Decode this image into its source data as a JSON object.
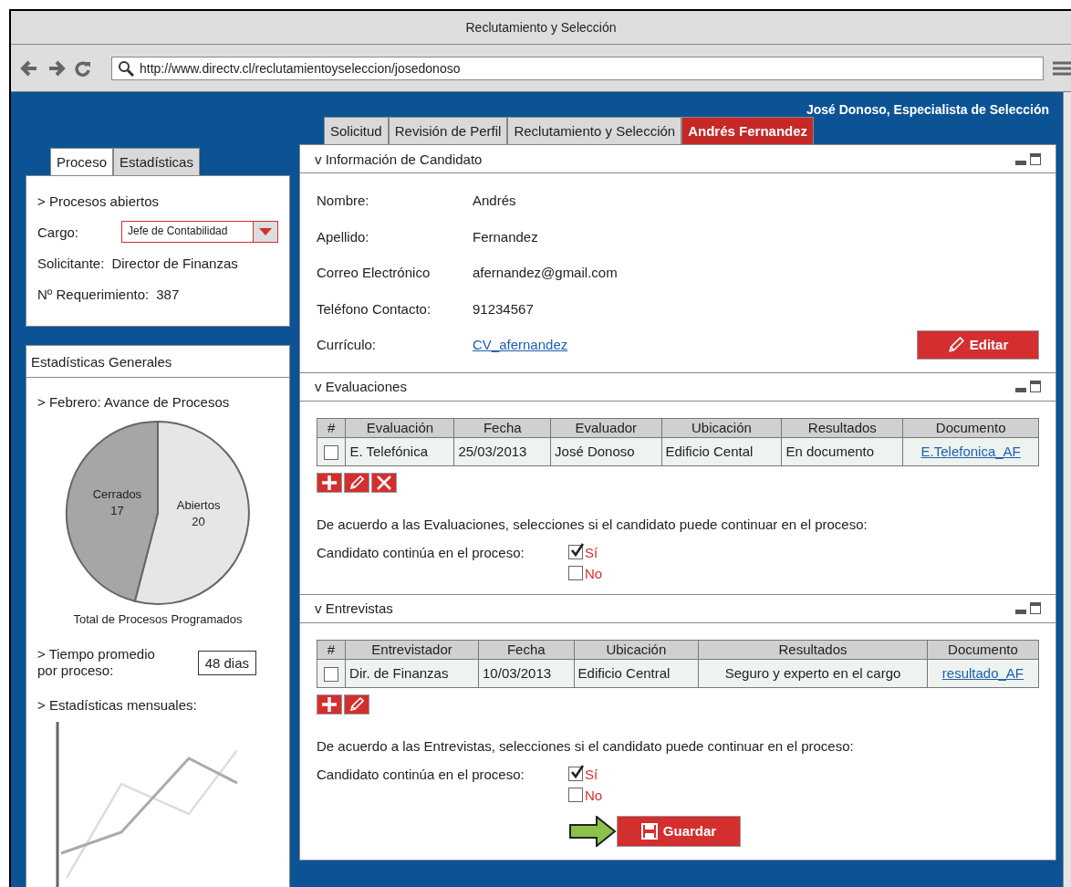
{
  "window": {
    "title": "Reclutamiento y Selección"
  },
  "address_bar": {
    "url": "http://www.directv.cl/reclutamientoyseleccion/josedonoso"
  },
  "user_label": "José Donoso, Especialista de Selección",
  "left_tabs": [
    {
      "label": "Proceso",
      "selected": true
    },
    {
      "label": "Estadísticas",
      "selected": false
    }
  ],
  "process_panel": {
    "heading": "> Procesos abiertos",
    "fields": [
      {
        "kind": "select",
        "label": "Cargo:",
        "value": "Jefe de Contabilidad"
      },
      {
        "kind": "text",
        "label": "Solicitante:",
        "value": "Director de Finanzas"
      },
      {
        "kind": "text",
        "label": "Nº Requerimiento:",
        "value": "387"
      }
    ]
  },
  "stats_panel": {
    "title": "Estadísticas Generales",
    "pie_heading": "> Febrero: Avance de Procesos",
    "chart_data": {
      "type": "pie",
      "title": "Total de Procesos Programados",
      "categories": [
        "Cerrados",
        "Abiertos"
      ],
      "values": [
        17,
        20
      ],
      "data_labels": true
    },
    "time_label": "> Tiempo promedio\npor proceso:",
    "time_value": "48 dias",
    "monthly_heading": "> Estadísticas mensuales:"
  },
  "main_tabs": [
    {
      "label": "Solicitud",
      "selected": false
    },
    {
      "label": "Revisión de Perfil",
      "selected": false
    },
    {
      "label": "Reclutamiento y Selección",
      "selected": false
    },
    {
      "label": "Andrés Fernandez",
      "selected": true
    }
  ],
  "sections": [
    {
      "kind": "info",
      "title": "v Información de Candidato",
      "fields": [
        {
          "kind": "text",
          "label": "Nombre:",
          "value": "Andrés"
        },
        {
          "kind": "text",
          "label": "Apellido:",
          "value": "Fernandez"
        },
        {
          "kind": "text",
          "label": "Correo Electrónico",
          "value": "afernandez@gmail.com"
        },
        {
          "kind": "text",
          "label": "Teléfono Contacto:",
          "value": "91234567"
        },
        {
          "kind": "link",
          "label": "Currículo:",
          "value": "CV_afernandez"
        }
      ],
      "button": "Editar"
    },
    {
      "kind": "table",
      "title": "v Evaluaciones",
      "columns": [
        "#",
        "Evaluación",
        "Fecha",
        "Evaluador",
        "Ubicación",
        "Resultados",
        "Documento"
      ],
      "rows": [
        {
          "checked": false,
          "cells": [
            "",
            "E. Telefónica",
            "25/03/2013",
            "José Donoso",
            "Edificio Cental",
            "En documento",
            "E.Telefonica_AF"
          ]
        }
      ],
      "deletable": true,
      "prompt": "De acuerdo a las Evaluaciones, selecciones si el candidato puede continuar en el proceso:",
      "question": "Candidato continúa en el proceso:",
      "options": [
        {
          "label": "Sí",
          "checked": true
        },
        {
          "label": "No",
          "checked": false
        }
      ]
    },
    {
      "kind": "table",
      "title": "v Entrevistas",
      "columns": [
        "#",
        "Entrevistador",
        "Fecha",
        "Ubicación",
        "Resultados",
        "Documento"
      ],
      "rows": [
        {
          "checked": false,
          "cells": [
            "",
            "Dir. de Finanzas",
            "10/03/2013",
            "Edificio Central",
            "Seguro y experto en el cargo",
            "resultado_AF"
          ]
        }
      ],
      "deletable": false,
      "prompt": "De acuerdo a las Entrevistas, selecciones si el candidato puede continuar en el proceso:",
      "question": "Candidato continúa en el proceso:",
      "options": [
        {
          "label": "Sí",
          "checked": true
        },
        {
          "label": "No",
          "checked": false
        }
      ],
      "save_button": "Guardar"
    }
  ]
}
